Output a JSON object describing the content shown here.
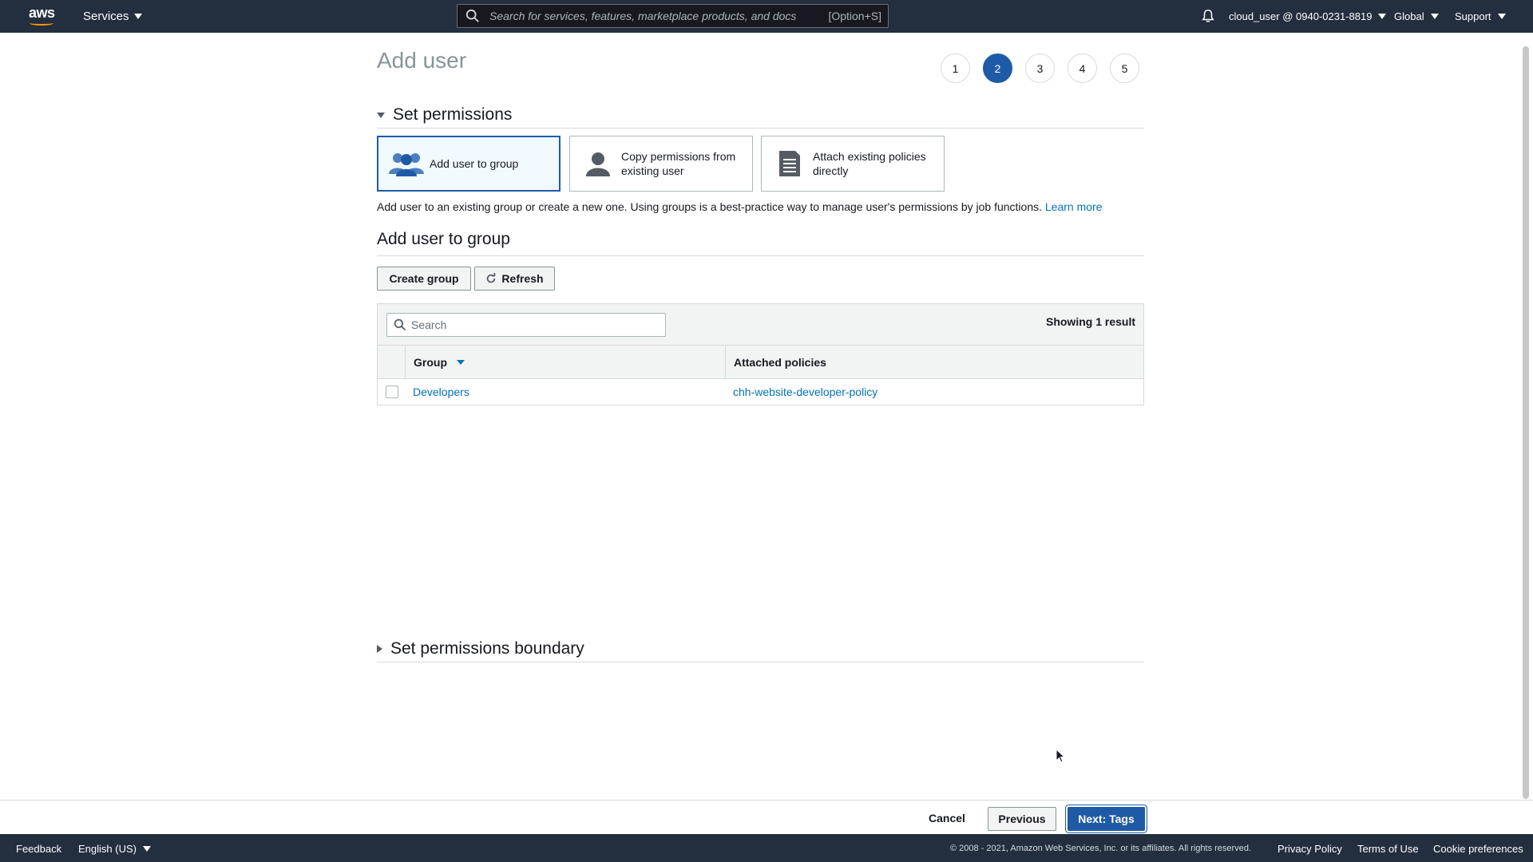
{
  "nav": {
    "services_label": "Services",
    "search_placeholder": "Search for services, features, marketplace products, and docs",
    "search_shortcut": "[Option+S]",
    "account_label": "cloud_user @ 0940-0231-8819",
    "region_label": "Global",
    "support_label": "Support",
    "logo_text": "aws"
  },
  "wizard": {
    "title": "Add user",
    "steps": [
      "1",
      "2",
      "3",
      "4",
      "5"
    ],
    "active_step": 2
  },
  "permissions": {
    "section_title": "Set permissions",
    "options": [
      {
        "label": "Add user to group",
        "icon": "group-icon",
        "selected": true
      },
      {
        "label": "Copy permissions from existing user",
        "icon": "user-icon",
        "selected": false
      },
      {
        "label": "Attach existing policies directly",
        "icon": "document-icon",
        "selected": false
      }
    ],
    "description": "Add user to an existing group or create a new one. Using groups is a best-practice way to manage user's permissions by job functions.",
    "learn_more": "Learn more"
  },
  "group_section": {
    "title": "Add user to group",
    "create_button": "Create group",
    "refresh_button": "Refresh",
    "search_placeholder": "Search",
    "showing": "Showing 1 result",
    "columns": [
      "Group",
      "Attached policies"
    ],
    "rows": [
      {
        "group": "Developers",
        "policies": "chh-website-developer-policy"
      }
    ]
  },
  "boundary": {
    "section_title": "Set permissions boundary"
  },
  "actions": {
    "cancel": "Cancel",
    "previous": "Previous",
    "next": "Next: Tags"
  },
  "footer": {
    "feedback": "Feedback",
    "language": "English (US)",
    "copyright": "© 2008 - 2021, Amazon Web Services, Inc. or its affiliates. All rights reserved.",
    "privacy": "Privacy Policy",
    "terms": "Terms of Use",
    "cookies": "Cookie preferences"
  },
  "colors": {
    "nav_bg": "#232f3e",
    "primary": "#1f5aa6",
    "link": "#0073bb"
  }
}
